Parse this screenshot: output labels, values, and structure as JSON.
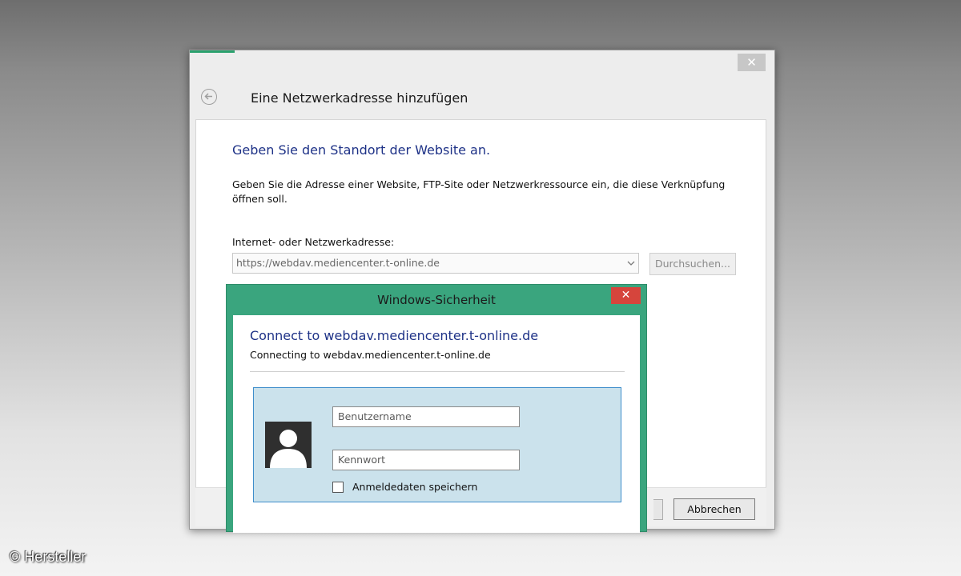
{
  "wizard": {
    "close_glyph": "✕",
    "back_icon": "back-arrow-icon",
    "title": "Eine Netzwerkadresse hinzufügen",
    "heading": "Geben Sie den Standort der Website an.",
    "description": "Geben Sie die Adresse einer Website, FTP-Site oder Netzwerkressource ein, die diese Verknüpfung öffnen soll.",
    "address_label": "Internet- oder Netzwerkadresse:",
    "address_value": "https://webdav.mediencenter.t-online.de",
    "browse_label": "Durchsuchen...",
    "cancel_label": "Abbrechen"
  },
  "security_dialog": {
    "title": "Windows-Sicherheit",
    "close_glyph": "✕",
    "heading": "Connect to webdav.mediencenter.t-online.de",
    "subheading": "Connecting to webdav.mediencenter.t-online.de",
    "username_placeholder": "Benutzername",
    "password_placeholder": "Kennwort",
    "remember_label": "Anmeldedaten speichern",
    "remember_checked": false
  },
  "colors": {
    "accent_green": "#3aa57e",
    "close_red": "#d6453c",
    "heading_blue": "#1e3287",
    "credential_box": "#cbe2ec"
  },
  "watermark": "© Hersteller"
}
